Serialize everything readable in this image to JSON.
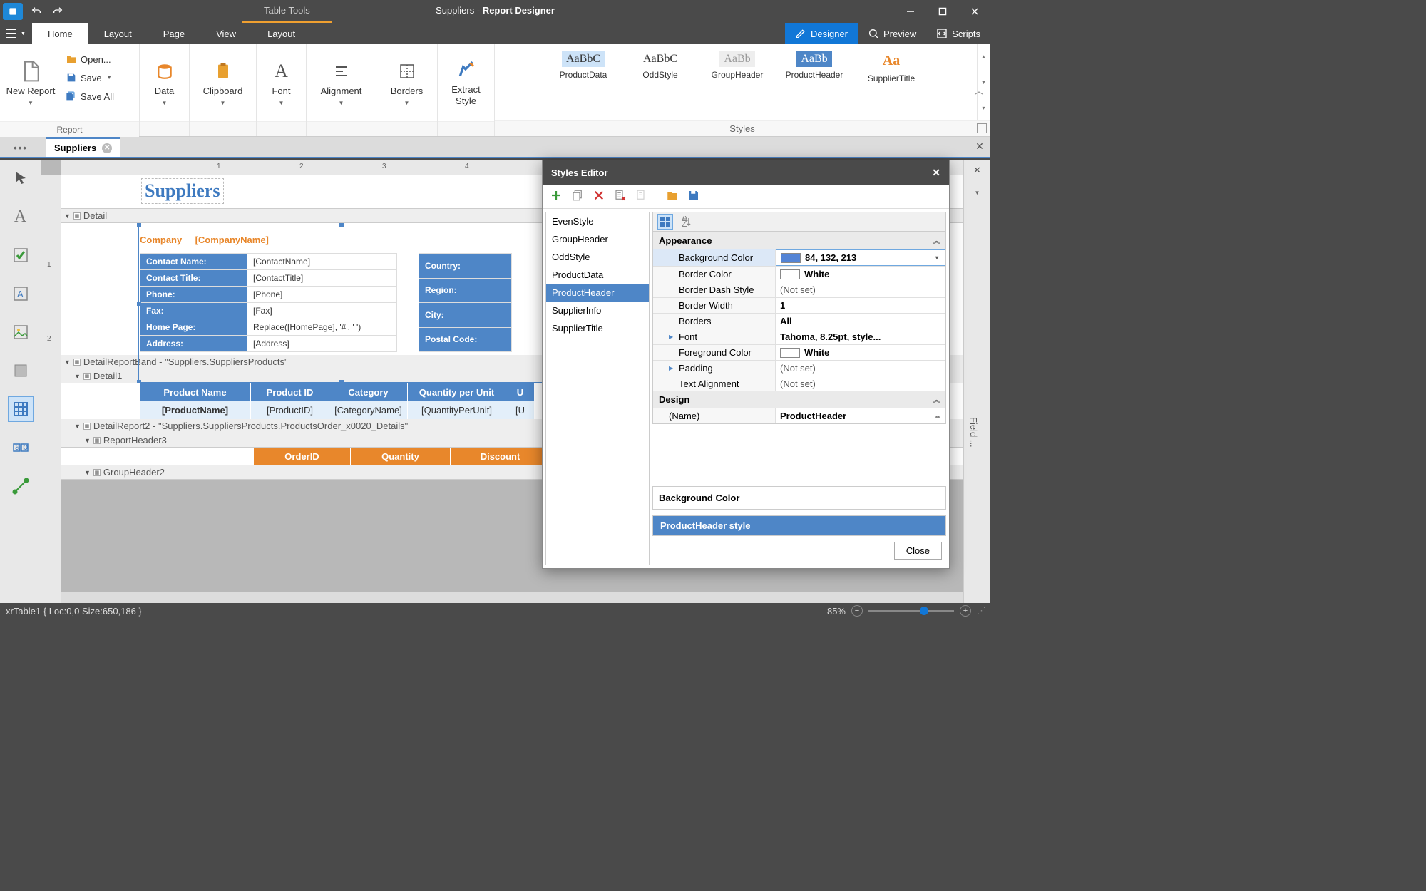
{
  "title_context": "Table Tools",
  "title_doc": "Suppliers",
  "title_app": "Report Designer",
  "tabs": [
    "Home",
    "Layout",
    "Page",
    "View",
    "Layout"
  ],
  "modes": {
    "designer": "Designer",
    "preview": "Preview",
    "scripts": "Scripts"
  },
  "ribbon": {
    "report_cap": "Report",
    "newreport": "New Report",
    "open": "Open...",
    "save": "Save",
    "saveall": "Save All",
    "data": "Data",
    "clipboard": "Clipboard",
    "font": "Font",
    "alignment": "Alignment",
    "borders": "Borders",
    "extract": "Extract\nStyle",
    "styles_cap": "Styles",
    "gallery": [
      {
        "sample": "AaBbC",
        "name": "ProductData",
        "bg": "#cde3f8",
        "color": "#333"
      },
      {
        "sample": "AaBbC",
        "name": "OddStyle",
        "bg": "#fff",
        "color": "#333"
      },
      {
        "sample": "AaBb",
        "name": "GroupHeader",
        "bg": "#eee",
        "color": "#999"
      },
      {
        "sample": "AaBb",
        "name": "ProductHeader",
        "bg": "#4e86c7",
        "color": "#fff"
      },
      {
        "sample": "Aa",
        "name": "SupplierTitle",
        "bg": "#fff",
        "color": "#e8872b"
      }
    ]
  },
  "doc_tab": "Suppliers",
  "ruler_h": [
    "1",
    "2",
    "3",
    "4"
  ],
  "ruler_v": [
    "1",
    "2"
  ],
  "bands": {
    "detail": "Detail",
    "sup_title": "Suppliers",
    "company_label": "Company",
    "company_field": "[CompanyName]",
    "fields_left": [
      {
        "l": "Contact Name:",
        "v": "[ContactName]"
      },
      {
        "l": "Contact Title:",
        "v": "[ContactTitle]"
      },
      {
        "l": "Phone:",
        "v": "[Phone]"
      },
      {
        "l": "Fax:",
        "v": "[Fax]"
      },
      {
        "l": "Home Page:",
        "v": "Replace([HomePage], '#', ' ')"
      },
      {
        "l": "Address:",
        "v": "[Address]"
      }
    ],
    "fields_right": [
      {
        "l": "Country:"
      },
      {
        "l": "Region:"
      },
      {
        "l": "City:"
      },
      {
        "l": "Postal Code:"
      }
    ],
    "drb": "DetailReportBand - \"Suppliers.SuppliersProducts\"",
    "detail1": "Detail1",
    "prod_h": [
      "Product Name",
      "Product ID",
      "Category",
      "Quantity per Unit",
      "U"
    ],
    "prod_d": [
      "[ProductName]",
      "[ProductID]",
      "[CategoryName]",
      "[QuantityPerUnit]",
      "[U"
    ],
    "dr2": "DetailReport2 - \"Suppliers.SuppliersProducts.ProductsOrder_x0020_Details\"",
    "rh3": "ReportHeader3",
    "ord_h": [
      "OrderID",
      "Quantity",
      "Discount"
    ],
    "gh2": "GroupHeader2"
  },
  "styles_editor": {
    "title": "Styles Editor",
    "list": [
      "EvenStyle",
      "GroupHeader",
      "OddStyle",
      "ProductData",
      "ProductHeader",
      "SupplierInfo",
      "SupplierTitle"
    ],
    "selected": "ProductHeader",
    "cat1": "Appearance",
    "props": [
      {
        "n": "Background Color",
        "v": "84, 132, 213",
        "sw": "#5484d5",
        "sel": true
      },
      {
        "n": "Border Color",
        "v": "White",
        "sw": "#ffffff"
      },
      {
        "n": "Border Dash Style",
        "v": "(Not set)",
        "ns": true
      },
      {
        "n": "Border Width",
        "v": "1"
      },
      {
        "n": "Borders",
        "v": "All"
      },
      {
        "n": "Font",
        "v": "Tahoma, 8.25pt, style...",
        "exp": true
      },
      {
        "n": "Foreground Color",
        "v": "White",
        "sw": "#ffffff"
      },
      {
        "n": "Padding",
        "v": "(Not set)",
        "ns": true,
        "exp": true
      },
      {
        "n": "Text Alignment",
        "v": "(Not set)",
        "ns": true
      }
    ],
    "cat2": "Design",
    "name_label": "(Name)",
    "name_val": "ProductHeader",
    "desc": "Background Color",
    "footer": "ProductHeader style",
    "close": "Close"
  },
  "right_panel": "Field ...",
  "status": {
    "sel": "xrTable1 { Loc:0,0 Size:650,186 }",
    "zoom": "85%"
  }
}
